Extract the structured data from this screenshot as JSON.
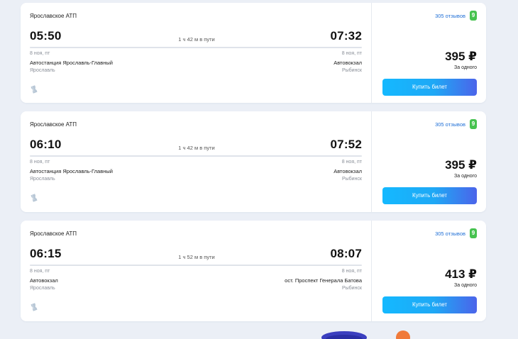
{
  "currency_note": "RUB",
  "colors": {
    "accent": "#1f6fd6",
    "rating": "#46c24f",
    "button_start": "#14b9ff",
    "button_end": "#4b64ea"
  },
  "trips": [
    {
      "carrier": "Ярославское АТП",
      "reviews": "305 отзывов",
      "rating": "9",
      "dep_time": "05:50",
      "arr_time": "07:32",
      "duration": "1 ч 42 м в пути",
      "dep_date": "8 ноя, пт",
      "arr_date": "8 ноя, пт",
      "dep_station": "Автостанция Ярославль-Главный",
      "arr_station": "Автовокзал",
      "dep_city": "Ярославль",
      "arr_city": "Рыбинск",
      "price": "395 ₽",
      "per_one": "За одного",
      "buy": "Купить билет",
      "icon": "ticket-icon"
    },
    {
      "carrier": "Ярославское АТП",
      "reviews": "305 отзывов",
      "rating": "9",
      "dep_time": "06:10",
      "arr_time": "07:52",
      "duration": "1 ч 42 м в пути",
      "dep_date": "8 ноя, пт",
      "arr_date": "8 ноя, пт",
      "dep_station": "Автостанция Ярославль-Главный",
      "arr_station": "Автовокзал",
      "dep_city": "Ярославль",
      "arr_city": "Рыбинск",
      "price": "395 ₽",
      "per_one": "За одного",
      "buy": "Купить билет",
      "icon": "ticket-icon"
    },
    {
      "carrier": "Ярославское АТП",
      "reviews": "305 отзывов",
      "rating": "9",
      "dep_time": "06:15",
      "arr_time": "08:07",
      "duration": "1 ч 52 м в пути",
      "dep_date": "8 ноя, пт",
      "arr_date": "8 ноя, пт",
      "dep_station": "Автовокзал",
      "arr_station": "ост. Проспект Генерала Батова",
      "dep_city": "Ярославль",
      "arr_city": "Рыбинск",
      "price": "413 ₽",
      "per_one": "За одного",
      "buy": "Купить билет",
      "icon": "ticket-icon"
    }
  ]
}
